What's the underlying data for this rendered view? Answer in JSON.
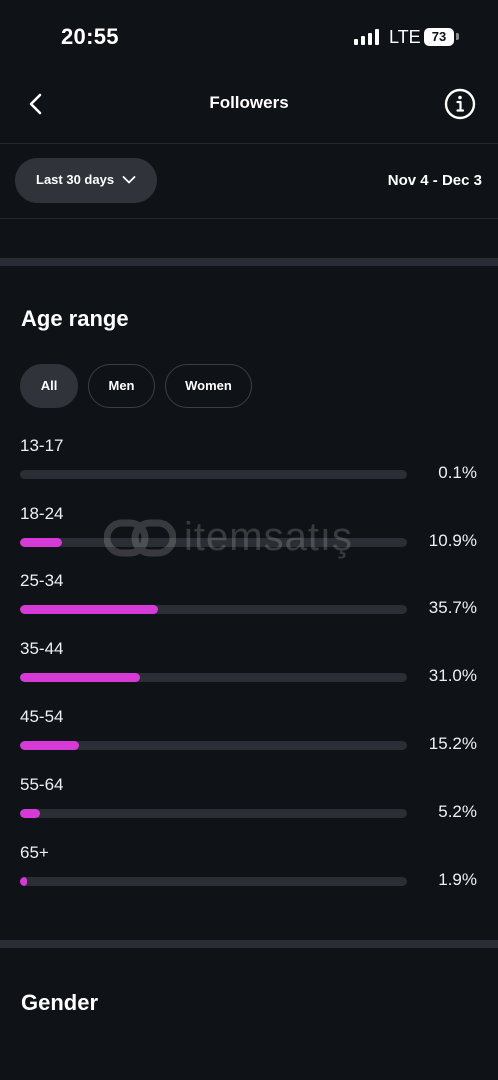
{
  "status_bar": {
    "time": "20:55",
    "network": "LTE",
    "battery": "73"
  },
  "header": {
    "title": "Followers",
    "back_icon": "chevron-left-icon",
    "info_icon": "info-icon"
  },
  "filter": {
    "period_label": "Last 30 days",
    "date_range": "Nov 4 - Dec 3"
  },
  "age_section": {
    "title": "Age range",
    "chips": [
      {
        "label": "All",
        "selected": true
      },
      {
        "label": "Men",
        "selected": false
      },
      {
        "label": "Women",
        "selected": false
      }
    ],
    "accent_color": "#d63ad6",
    "track_color": "#2b2f35",
    "rows": [
      {
        "label": "13-17",
        "percent_text": "0.1%",
        "value": 0.1
      },
      {
        "label": "18-24",
        "percent_text": "10.9%",
        "value": 10.9
      },
      {
        "label": "25-34",
        "percent_text": "35.7%",
        "value": 35.7
      },
      {
        "label": "35-44",
        "percent_text": "31.0%",
        "value": 31.0
      },
      {
        "label": "45-54",
        "percent_text": "15.2%",
        "value": 15.2
      },
      {
        "label": "55-64",
        "percent_text": "5.2%",
        "value": 5.2
      },
      {
        "label": "65+",
        "percent_text": "1.9%",
        "value": 1.9
      }
    ]
  },
  "gender_section": {
    "title": "Gender"
  },
  "watermark": {
    "text": "itemsatış"
  }
}
